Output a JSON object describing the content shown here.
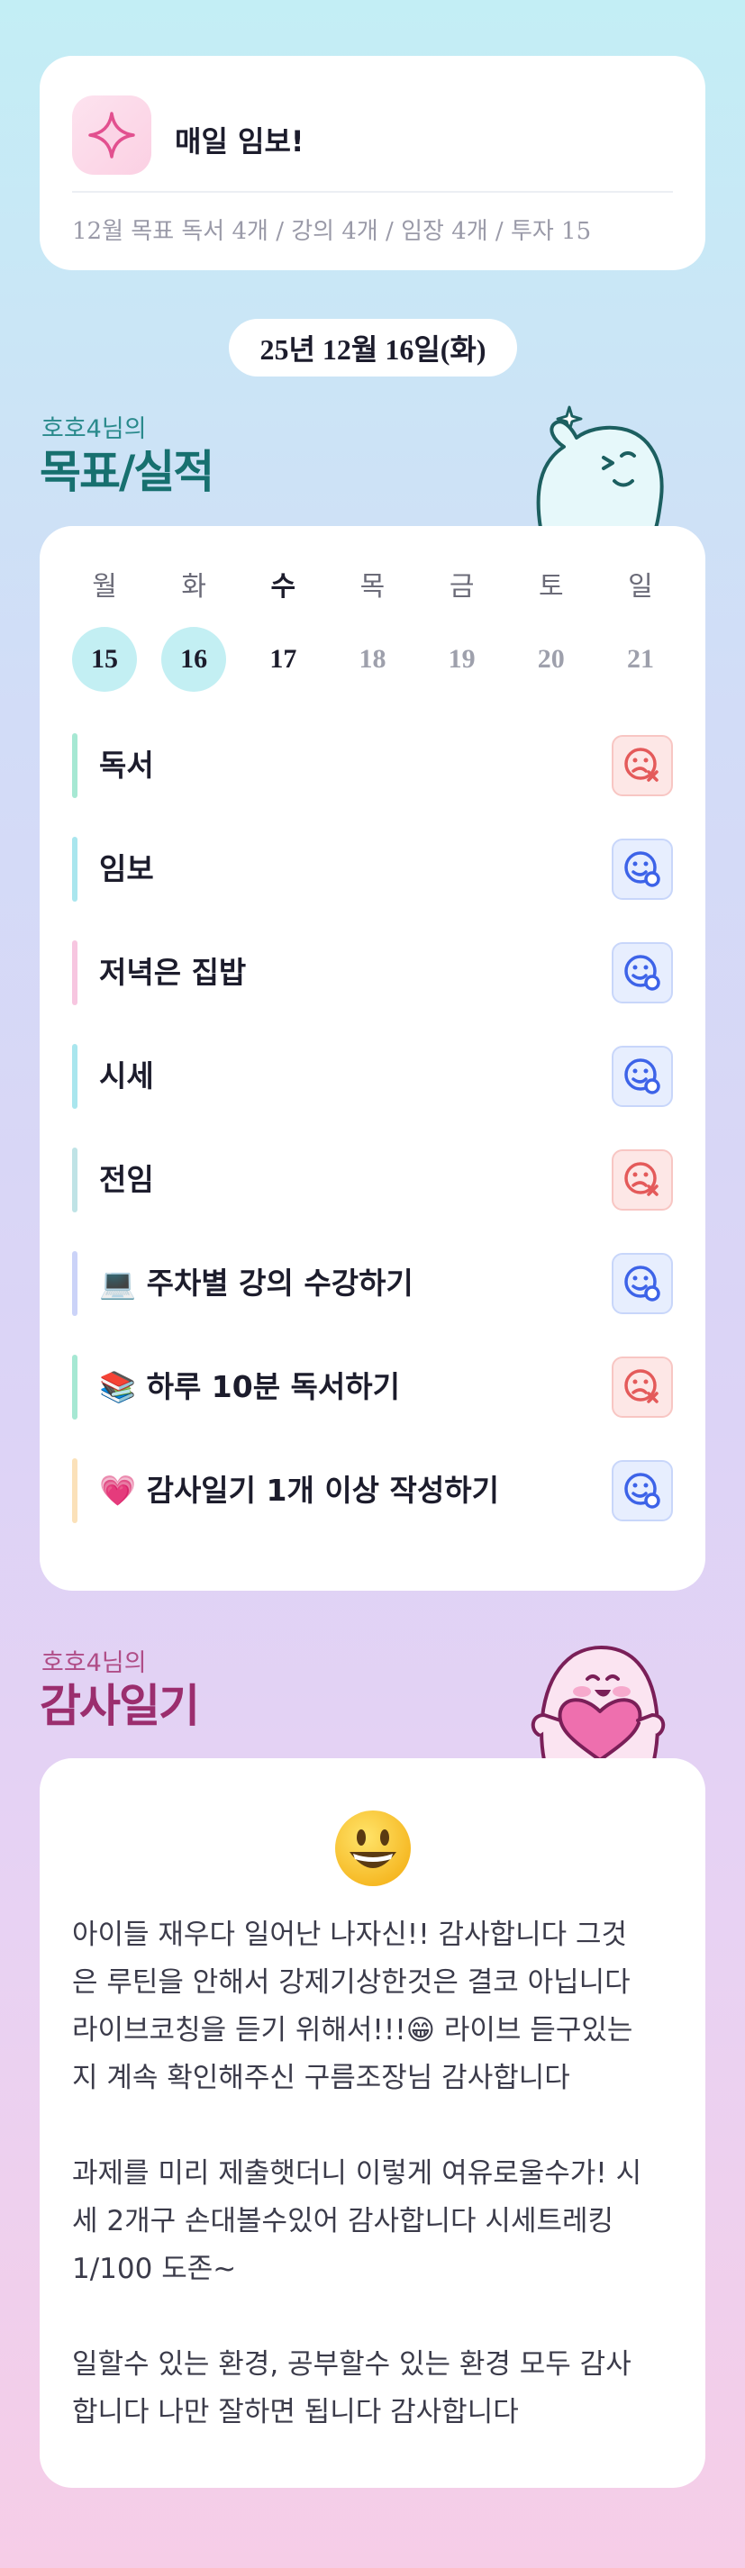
{
  "goal": {
    "icon": "sparkle-icon",
    "title": "매일 임보!",
    "summary": "12월 목표  독서 4개 / 강의 4개 / 임장 4개 / 투자 15"
  },
  "date": "25년 12월 16일(화)",
  "goals_section": {
    "subtitle": "호호4님의",
    "title": "목표/실적"
  },
  "week": {
    "weekdays": [
      "월",
      "화",
      "수",
      "목",
      "금",
      "토",
      "일"
    ],
    "days": [
      "15",
      "16",
      "17",
      "18",
      "19",
      "20",
      "21"
    ],
    "completed_days": [
      "15",
      "16"
    ],
    "today": "17"
  },
  "tasks": [
    {
      "label": "독서",
      "status": "fail",
      "bar_color": "#a6e8d3"
    },
    {
      "label": "임보",
      "status": "ok",
      "bar_color": "#a9e6ee"
    },
    {
      "label": "저녁은 집밥",
      "status": "ok",
      "bar_color": "#f7c6e0"
    },
    {
      "label": "시세",
      "status": "ok",
      "bar_color": "#a9e6ee"
    },
    {
      "label": "전임",
      "status": "fail",
      "bar_color": "#bfe3e6"
    },
    {
      "label": "💻 주차별 강의 수강하기",
      "status": "ok",
      "bar_color": "#cbd3f8"
    },
    {
      "label": "📚 하루 10분 독서하기",
      "status": "fail",
      "bar_color": "#a6e8d3"
    },
    {
      "label": "💗 감사일기 1개 이상 작성하기",
      "status": "ok",
      "bar_color": "#fbe1b9"
    }
  ],
  "gratitude_section": {
    "subtitle": "호호4님의",
    "title": "감사일기",
    "emoji": "grinning-face-icon",
    "text": "아이들 재우다 일어난 나자신!! 감사합니다 그것\n은 루틴을 안해서 강제기상한것은 결코 아닙니다\n라이브코칭을 듣기 위해서!!!😁 라이브 듣구있는\n지 계속 확인해주신 구름조장님 감사합니다\n\n과제를 미리 제출햇더니 이렇게 여유로울수가! 시\n세 2개구 손대볼수있어 감사합니다 시세트레킹\n1/100 도존~\n\n일할수 있는 환경, 공부할수 있는 환경 모두 감사\n합니다 나만 잘하면 됩니다 감사합니다"
  },
  "colors": {
    "ok_icon": "#3d63e8",
    "fail_icon": "#e45a5a",
    "goal_accent": "#e2508f",
    "teal_heading": "#17706f",
    "pink_heading": "#9b2e6e"
  }
}
